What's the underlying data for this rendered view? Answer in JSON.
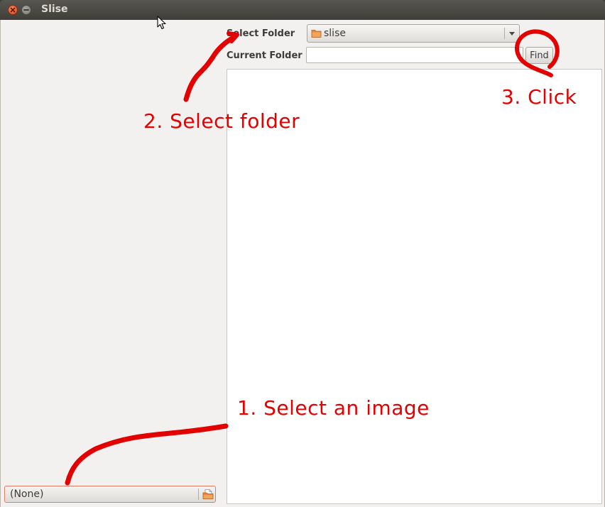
{
  "window": {
    "title": "Slise"
  },
  "toolbar": {
    "select_folder_label": "Select Folder",
    "current_folder_label": "Current Folder",
    "folder_combo_value": "slise",
    "current_folder_value": "",
    "find_label": "Find"
  },
  "image_chooser": {
    "value": "(None)"
  },
  "annotations": {
    "step1": "1. Select an image",
    "step2": "2. Select folder",
    "step3": "3. Click",
    "color": "#e30000"
  },
  "icons": {
    "close": "close-icon",
    "minimize": "minimize-icon",
    "folder": "folder-icon",
    "dropdown": "chevron-down-icon",
    "file_open": "document-open-icon",
    "cursor": "mouse-pointer-icon"
  }
}
